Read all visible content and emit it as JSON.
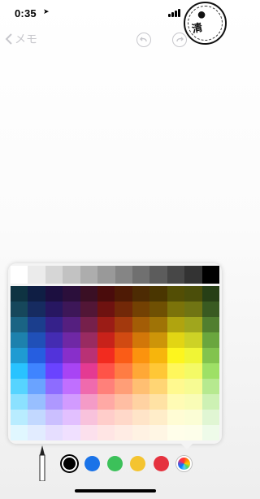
{
  "status_bar": {
    "time": "0:35",
    "location_icon": "location-arrow-icon"
  },
  "badge": {
    "logo": "apple-icon",
    "text": "清"
  },
  "nav": {
    "back_label": "メモ",
    "undo_icon": "undo-icon",
    "redo_icon": "redo-icon"
  },
  "palette": {
    "grey_row": [
      "#ffffff",
      "#ebebeb",
      "#d6d6d6",
      "#c2c2c2",
      "#adadad",
      "#999999",
      "#858585",
      "#707070",
      "#5c5c5c",
      "#474747",
      "#333333",
      "#000000"
    ],
    "rows": [
      [
        "#0e3342",
        "#0f1e44",
        "#1c0f40",
        "#2b0f3b",
        "#3a0f24",
        "#4a0c0c",
        "#4e1a05",
        "#4d2b03",
        "#4a3601",
        "#534e05",
        "#4b4e0a",
        "#273f16"
      ],
      [
        "#16475b",
        "#162b60",
        "#271761",
        "#3d1758",
        "#521636",
        "#6e1210",
        "#722808",
        "#734103",
        "#6f5003",
        "#7b730a",
        "#707413",
        "#395a21"
      ],
      [
        "#1a6484",
        "#1b3e8d",
        "#35218a",
        "#551f7f",
        "#76204b",
        "#9b1c16",
        "#a3390d",
        "#a35d06",
        "#9f7306",
        "#b0a40f",
        "#a0a61d",
        "#517f2f"
      ],
      [
        "#1d81ad",
        "#2050b8",
        "#442cb2",
        "#6f28a5",
        "#992b61",
        "#c8221a",
        "#d14a12",
        "#d27709",
        "#cd9509",
        "#e2d514",
        "#cdd226",
        "#6aa63e"
      ],
      [
        "#1f9bd2",
        "#265ee0",
        "#5233da",
        "#882fca",
        "#b93175",
        "#f22b1f",
        "#fa5c17",
        "#fb930e",
        "#f7b50c",
        "#fdf51e",
        "#f0f535",
        "#82c34e"
      ],
      [
        "#29c3ff",
        "#3f84ff",
        "#6a43ff",
        "#a844f4",
        "#e43a92",
        "#ff5348",
        "#ff7c43",
        "#ffa836",
        "#ffc736",
        "#fff75c",
        "#f4fa66",
        "#9ee066"
      ],
      [
        "#56d4ff",
        "#6aa3ff",
        "#8d6cff",
        "#c06fff",
        "#ef6aad",
        "#ff807a",
        "#ff9e77",
        "#ffbf72",
        "#ffd574",
        "#fff98f",
        "#f7fb93",
        "#b6e98f"
      ],
      [
        "#8be1ff",
        "#98bfff",
        "#ae98ff",
        "#d29bff",
        "#f49bc7",
        "#ffa9a5",
        "#ffbea3",
        "#ffd2a2",
        "#ffe2a4",
        "#fffbb5",
        "#f9fcb6",
        "#cdf1b4"
      ],
      [
        "#b8ecff",
        "#c2d8ff",
        "#cbbfff",
        "#e2c0ff",
        "#f8c2dc",
        "#ffcdca",
        "#ffd8c9",
        "#ffe4c8",
        "#ffedc9",
        "#fffcd4",
        "#fbfdd5",
        "#e0f6d3"
      ],
      [
        "#e0f7ff",
        "#e2ecff",
        "#e6deff",
        "#f0e0ff",
        "#fce0ed",
        "#ffe5e4",
        "#ffece4",
        "#fff2e3",
        "#fff6e4",
        "#fffeea",
        "#fdfeea",
        "#eefbe9"
      ]
    ]
  },
  "toolbar": {
    "pen_icon": "pen-tool-icon",
    "swatches": [
      {
        "name": "black-swatch",
        "color": "#000000",
        "selected": true
      },
      {
        "name": "blue-swatch",
        "color": "#1a73e8"
      },
      {
        "name": "green-swatch",
        "color": "#3cc15a"
      },
      {
        "name": "yellow-swatch",
        "color": "#f4c430"
      },
      {
        "name": "red-swatch",
        "color": "#e5323f"
      }
    ],
    "wheel_icon": "color-wheel-icon"
  }
}
